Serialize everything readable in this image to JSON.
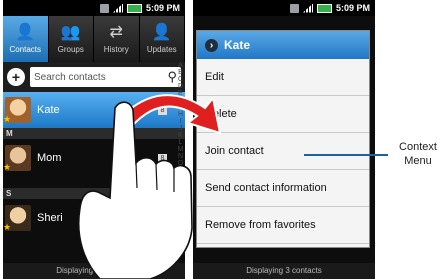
{
  "left_screen": {
    "status": {
      "time": "5:09 PM"
    },
    "tabs": [
      {
        "label": "Contacts",
        "icon": "person-icon",
        "glyph": "👤",
        "active": true
      },
      {
        "label": "Groups",
        "icon": "group-icon",
        "glyph": "👥"
      },
      {
        "label": "History",
        "icon": "history-icon",
        "glyph": "⇄"
      },
      {
        "label": "Updates",
        "icon": "updates-icon",
        "glyph": "👤"
      }
    ],
    "search": {
      "placeholder": "Search contacts"
    },
    "contacts": [
      {
        "name": "Kate",
        "section": ""
      },
      {
        "name": "Mom",
        "section": "M"
      },
      {
        "name": "Sheri",
        "section": "S"
      }
    ],
    "footer": "Displaying 3 contacts"
  },
  "right_screen": {
    "status": {
      "time": "5:09 PM"
    },
    "menu": {
      "title": "Kate",
      "items": [
        "Edit",
        "Delete",
        "Join contact",
        "Send contact information",
        "Remove from favorites"
      ]
    },
    "footer": "Displaying 3 contacts"
  },
  "callout": {
    "label_line1": "Context",
    "label_line2": "Menu"
  },
  "colors": {
    "accent": "#2277c6",
    "callout_line": "#1f5fa8",
    "arrow": "#e02020"
  }
}
